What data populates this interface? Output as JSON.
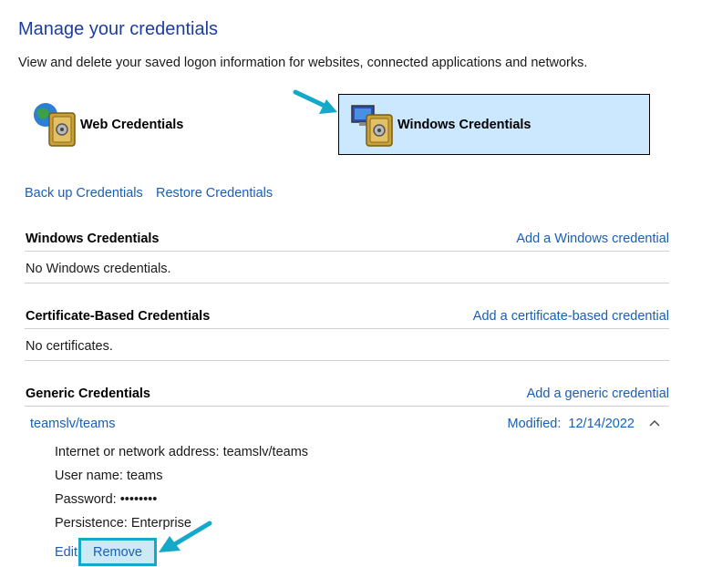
{
  "header": {
    "title": "Manage your credentials",
    "subtitle": "View and delete your saved logon information for websites, connected applications and networks."
  },
  "credential_types": {
    "web": "Web Credentials",
    "windows": "Windows Credentials"
  },
  "actions": {
    "backup": "Back up Credentials",
    "restore": "Restore Credentials"
  },
  "sections": {
    "windows": {
      "heading": "Windows Credentials",
      "add_link": "Add a Windows credential",
      "empty": "No Windows credentials."
    },
    "certificate": {
      "heading": "Certificate-Based Credentials",
      "add_link": "Add a certificate-based credential",
      "empty": "No certificates."
    },
    "generic": {
      "heading": "Generic Credentials",
      "add_link": "Add a generic credential"
    }
  },
  "generic_entry": {
    "name": "teamslv/teams",
    "modified_label": "Modified:",
    "modified_date": "12/14/2022",
    "details": {
      "address": "Internet or network address:  teamslv/teams",
      "username": "User name:  teams",
      "password": "Password:  ••••••••",
      "persistence": "Persistence:  Enterprise"
    },
    "edit_label": "Edit",
    "remove_label": "Remove"
  },
  "colors": {
    "accent_link": "#1a5fb4",
    "title": "#1e3e9e",
    "selected_bg": "#cce8ff",
    "callout": "#14a9c9"
  },
  "icons": [
    "globe-vault-icon",
    "monitor-vault-icon",
    "chevron-up-icon",
    "callout-arrow-icon"
  ]
}
